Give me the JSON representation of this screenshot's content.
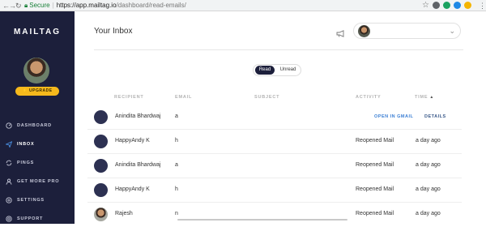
{
  "browser": {
    "secure_label": "Secure",
    "url_host": "https://app.mailtag.io",
    "url_path": "/dashboard/read-emails/"
  },
  "sidebar": {
    "brand": "MAILTAG",
    "upgrade_label": "⚡ UPGRADE",
    "items": [
      {
        "label": "DASHBOARD",
        "icon": "dashboard-icon",
        "active": false
      },
      {
        "label": "INBOX",
        "icon": "send-icon",
        "active": true
      },
      {
        "label": "PINGS",
        "icon": "sync-icon",
        "active": false
      },
      {
        "label": "GET MORE PRO",
        "icon": "user-icon",
        "active": false
      },
      {
        "label": "SETTINGS",
        "icon": "gear-icon",
        "active": false
      },
      {
        "label": "SUPPORT",
        "icon": "help-icon",
        "active": false
      }
    ]
  },
  "header": {
    "title": "Your Inbox"
  },
  "filter": {
    "read_label": "Read",
    "unread_label": "Unread",
    "selected": "Read"
  },
  "table": {
    "columns": {
      "recipient": "RECIPIENT",
      "email": "EMAIL",
      "subject": "SUBJECT",
      "activity": "ACTIVITY",
      "time": "TIME"
    },
    "rows": [
      {
        "name": "Anindita Bhardwaj",
        "email": "a",
        "activity": "",
        "time": "",
        "open_label": "OPEN IN GMAIL",
        "details_label": "DETAILS",
        "hovered": true
      },
      {
        "name": "HappyAndy K",
        "email": "h",
        "activity": "Reopened Mail",
        "time": "a day ago"
      },
      {
        "name": "Anindita Bhardwaj",
        "email": "a",
        "activity": "Reopened Mail",
        "time": "a day ago"
      },
      {
        "name": "HappyAndy K",
        "email": "h",
        "activity": "Reopened Mail",
        "time": "a day ago"
      },
      {
        "name": "Rajesh",
        "email": "n",
        "activity": "Reopened Mail",
        "time": "a day ago"
      }
    ]
  },
  "colors": {
    "sidebar_bg": "#1c1f3b",
    "accent_upgrade": "#f6b91c",
    "link_blue": "#3b7fd4"
  }
}
